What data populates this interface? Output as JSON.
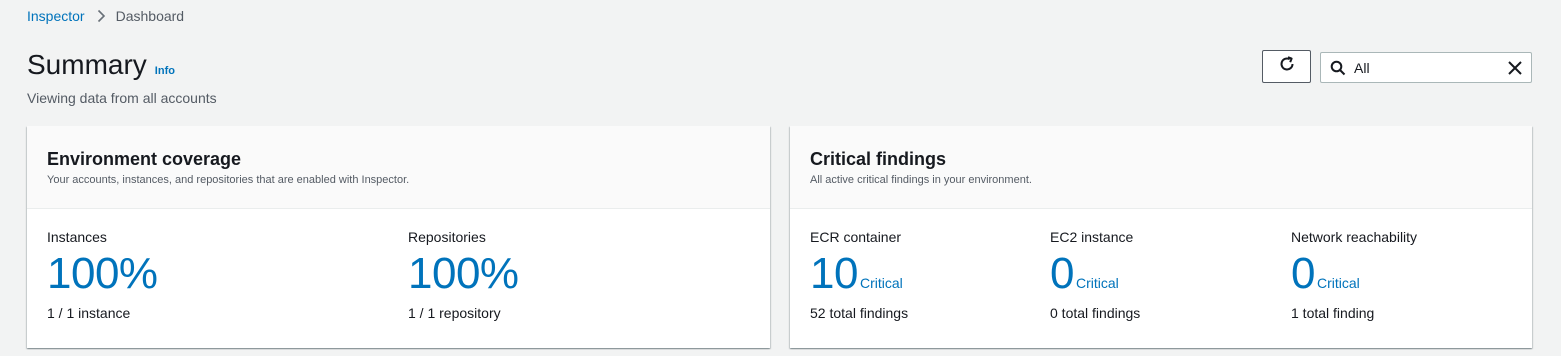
{
  "breadcrumb": {
    "root": "Inspector",
    "current": "Dashboard"
  },
  "page": {
    "title": "Summary",
    "info": "Info",
    "subtitle": "Viewing data from all accounts"
  },
  "filter": {
    "value": "All"
  },
  "coverage": {
    "title": "Environment coverage",
    "description": "Your accounts, instances, and repositories that are enabled with Inspector.",
    "metrics": [
      {
        "label": "Instances",
        "value": "100%",
        "detail": "1 / 1 instance"
      },
      {
        "label": "Repositories",
        "value": "100%",
        "detail": "1 / 1 repository"
      }
    ]
  },
  "critical": {
    "title": "Critical findings",
    "description": "All active critical findings in your environment.",
    "severity_label": "Critical",
    "metrics": [
      {
        "label": "ECR container",
        "value": "10",
        "detail": "52 total findings"
      },
      {
        "label": "EC2 instance",
        "value": "0",
        "detail": "0 total findings"
      },
      {
        "label": "Network reachability",
        "value": "0",
        "detail": "1 total finding"
      }
    ]
  },
  "colors": {
    "link": "#0073bb",
    "background": "#f2f3f3",
    "text": "#16191f",
    "muted": "#545b64"
  }
}
